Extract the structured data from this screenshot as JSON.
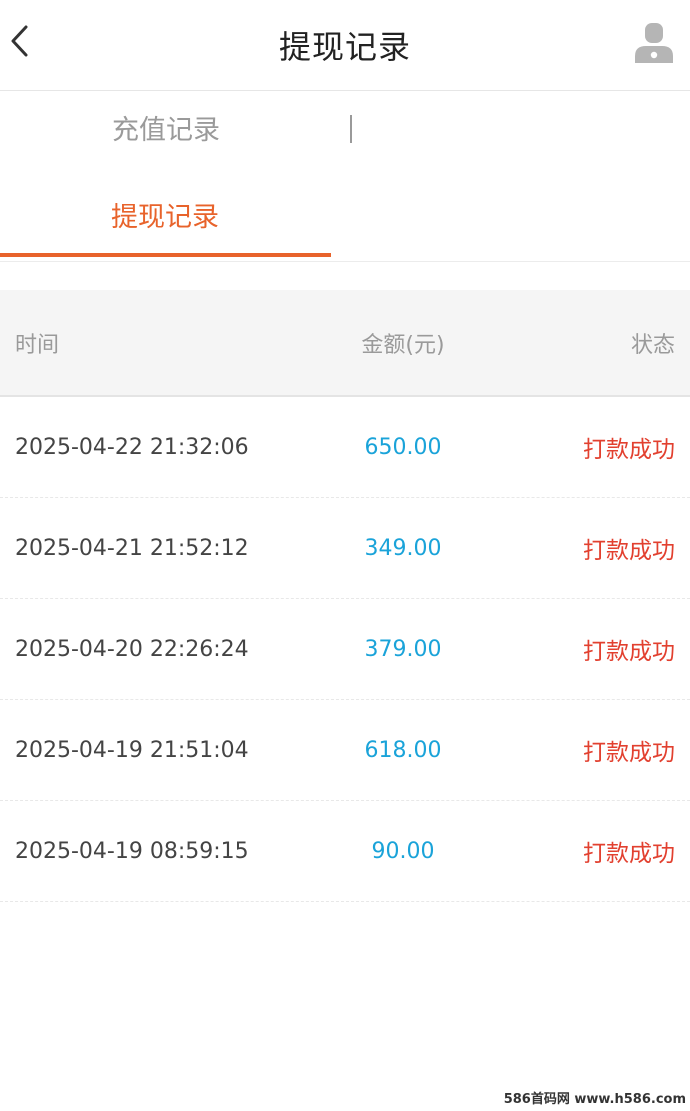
{
  "header": {
    "title": "提现记录",
    "back_icon": "chevron-left-icon",
    "user_icon": "user-icon"
  },
  "tabs": [
    {
      "label": "充值记录",
      "active": false
    },
    {
      "label": "提现记录",
      "active": true
    }
  ],
  "colors": {
    "accent": "#e8632b",
    "amount": "#1aa3d9",
    "status_success": "#e2402f"
  },
  "table": {
    "columns": [
      "时间",
      "金额(元)",
      "状态"
    ],
    "rows": [
      {
        "time": "2025-04-22 21:32:06",
        "amount": "650.00",
        "status": "打款成功"
      },
      {
        "time": "2025-04-21 21:52:12",
        "amount": "349.00",
        "status": "打款成功"
      },
      {
        "time": "2025-04-20 22:26:24",
        "amount": "379.00",
        "status": "打款成功"
      },
      {
        "time": "2025-04-19 21:51:04",
        "amount": "618.00",
        "status": "打款成功"
      },
      {
        "time": "2025-04-19 08:59:15",
        "amount": "90.00",
        "status": "打款成功"
      }
    ]
  },
  "watermark": "586首码网 www.h586.com"
}
